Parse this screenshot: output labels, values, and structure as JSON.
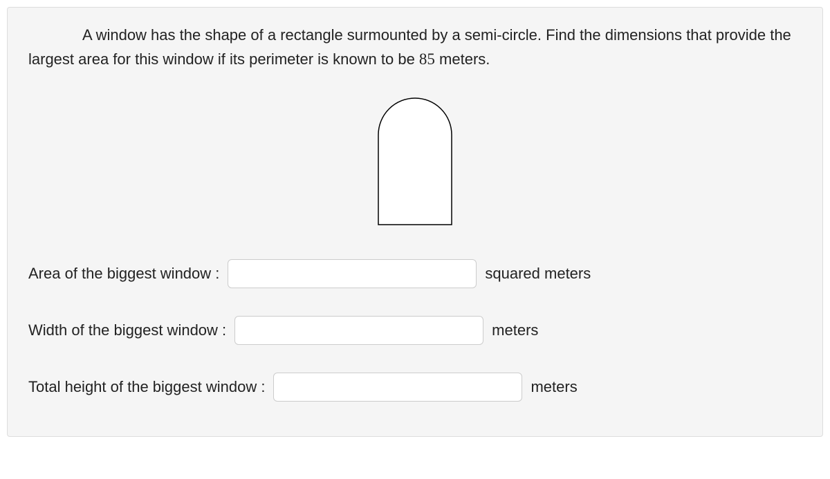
{
  "question": {
    "text_part1": "A window has the shape of a rectangle surmounted by a semi-circle. Find the dimensions that provide the largest area for this window if its perimeter is known to be ",
    "perimeter_value": "85",
    "text_part2": " meters."
  },
  "answers": {
    "area": {
      "label": "Area of the biggest window :",
      "value": "",
      "unit": "squared meters"
    },
    "width": {
      "label": "Width of the biggest window :",
      "value": "",
      "unit": "meters"
    },
    "height": {
      "label": "Total height of the biggest window :",
      "value": "",
      "unit": "meters"
    }
  }
}
